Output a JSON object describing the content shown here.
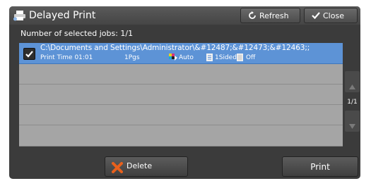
{
  "window": {
    "title": "Delayed Print",
    "title_icon": "printer-icon"
  },
  "header": {
    "refresh_label": "Refresh",
    "refresh_icon": "refresh-icon",
    "close_label": "Close",
    "close_icon": "checkmark-icon"
  },
  "selection": {
    "count_label": "Number of selected jobs: 1/1"
  },
  "jobs": [
    {
      "selected": true,
      "name": "C:\\Documents and Settings\\Administrator\\&#12487;&#12473;&#12463;;",
      "print_time": "Print Time 01:01",
      "pages": "1Pgs",
      "color_mode": "Auto",
      "sided": "1Sided",
      "staple": "Off"
    }
  ],
  "pager": {
    "indicator": "1/1"
  },
  "footer": {
    "delete_label": "Delete",
    "print_label": "Print"
  },
  "colors": {
    "selected_row": "#5d93d6",
    "empty_row": "#a5a5a5",
    "panel_bg": "#3b3b3b",
    "delete_icon": "#e8601c"
  }
}
